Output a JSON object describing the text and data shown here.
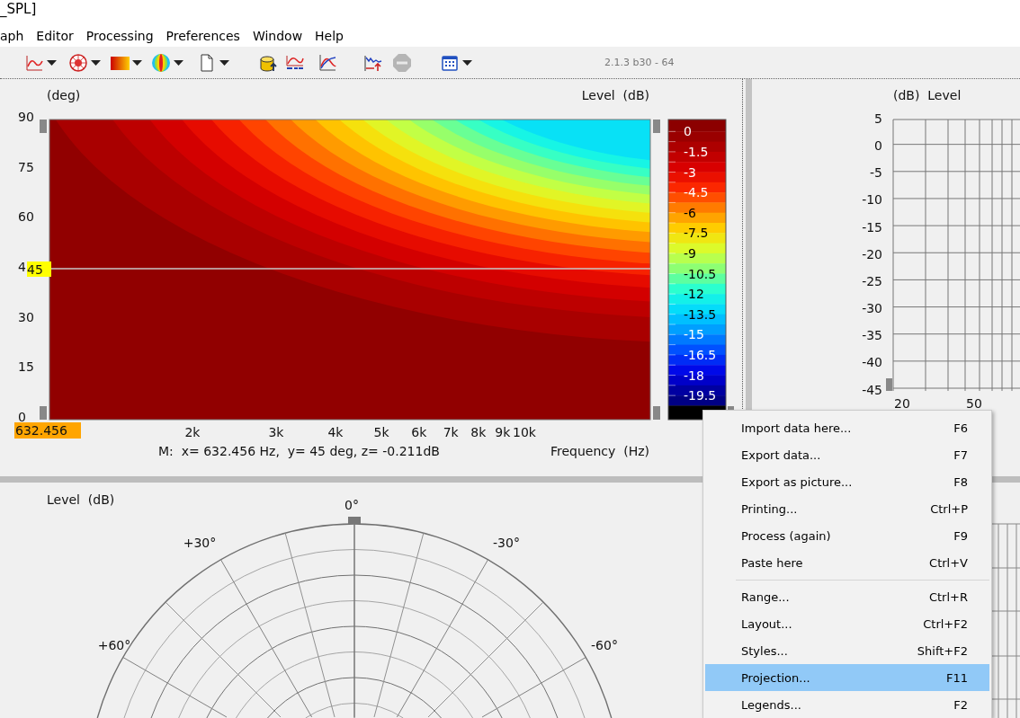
{
  "window": {
    "title": "_SPL]"
  },
  "menu_bar": [
    "aph",
    "Editor",
    "Processing",
    "Preferences",
    "Window",
    "Help"
  ],
  "toolbar": {
    "version": "2.1.3 b30 - 64"
  },
  "contour_plot": {
    "y_axis_label": "(deg)",
    "colorbar_label": "Level  (dB)",
    "y_ticks": [
      "90",
      "75",
      "60",
      "4",
      "30",
      "15",
      "0"
    ],
    "x_ticks": [
      "2k",
      "3k",
      "4k",
      "5k",
      "6k",
      "7k",
      "8k",
      "9k",
      "10k"
    ],
    "x_axis_label": "Frequency  (Hz)",
    "cursor": {
      "y_value": "45",
      "x_value": "632.456",
      "readout": "M:  x= 632.456 Hz,  y= 45 deg, z= -0.211dB"
    },
    "colorbar_ticks": [
      "0",
      "-1.5",
      "-3",
      "-4.5",
      "-6",
      "-7.5",
      "-9",
      "-10.5",
      "-12",
      "-13.5",
      "-15",
      "-16.5",
      "-18",
      "-19.5"
    ]
  },
  "level_plot": {
    "axis_label": "(dB)  Level",
    "y_ticks": [
      "5",
      "0",
      "-5",
      "-10",
      "-15",
      "-20",
      "-25",
      "-30",
      "-35",
      "-40",
      "-45"
    ],
    "x_ticks": [
      "20",
      "50"
    ]
  },
  "polar_plot": {
    "axis_label": "Level  (dB)",
    "angle_labels": [
      "0°",
      "+30°",
      "-30°",
      "+60°",
      "-60°"
    ]
  },
  "context_menu": {
    "items": [
      {
        "kind": "item",
        "label": "Import data here...",
        "shortcut": "F6",
        "selected": false
      },
      {
        "kind": "item",
        "label": "Export data...",
        "shortcut": "F7",
        "selected": false
      },
      {
        "kind": "item",
        "label": "Export as picture...",
        "shortcut": "F8",
        "selected": false
      },
      {
        "kind": "item",
        "label": "Printing...",
        "shortcut": "Ctrl+P",
        "selected": false
      },
      {
        "kind": "item",
        "label": "Process (again)",
        "shortcut": "F9",
        "selected": false
      },
      {
        "kind": "item",
        "label": "Paste here",
        "shortcut": "Ctrl+V",
        "selected": false
      },
      {
        "kind": "separator"
      },
      {
        "kind": "item",
        "label": "Range...",
        "shortcut": "Ctrl+R",
        "selected": false
      },
      {
        "kind": "item",
        "label": "Layout...",
        "shortcut": "Ctrl+F2",
        "selected": false
      },
      {
        "kind": "item",
        "label": "Styles...",
        "shortcut": "Shift+F2",
        "selected": false
      },
      {
        "kind": "item",
        "label": "Projection...",
        "shortcut": "F11",
        "selected": true
      },
      {
        "kind": "item",
        "label": "Legends...",
        "shortcut": "F2",
        "selected": false
      }
    ]
  }
}
